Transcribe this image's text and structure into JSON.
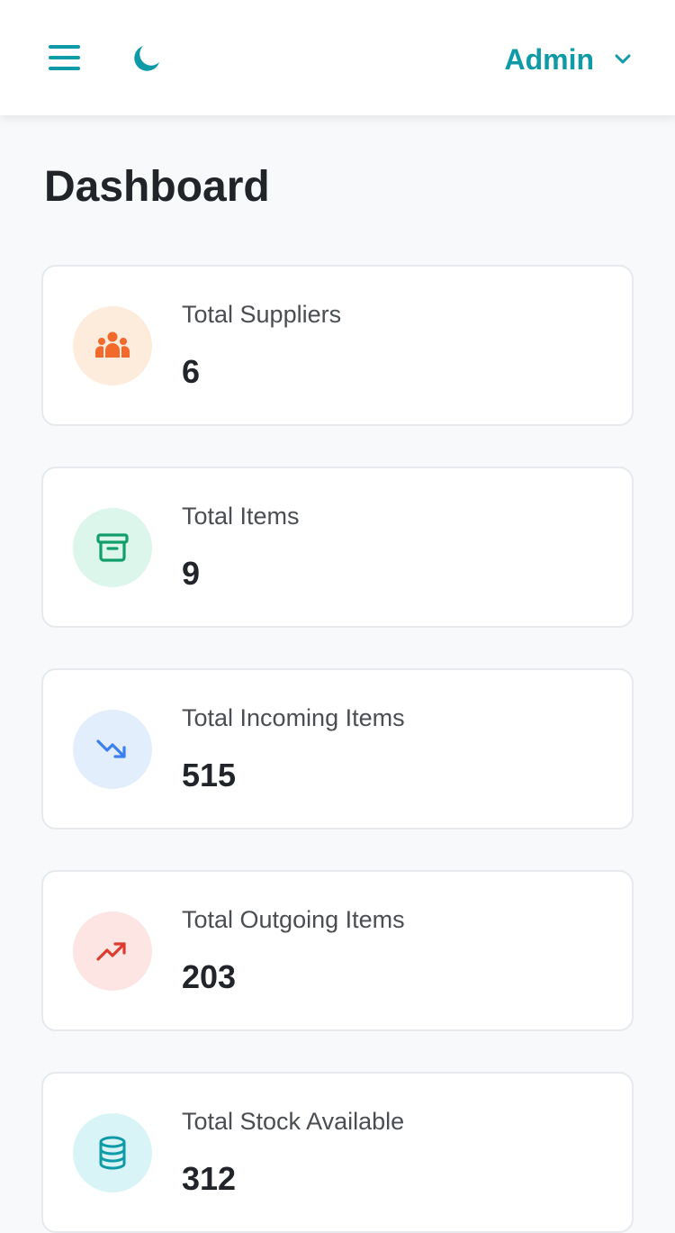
{
  "header": {
    "user_name": "Admin",
    "menu_icon": "hamburger-menu-icon",
    "theme_icon": "moon-icon",
    "dropdown_icon": "chevron-down-icon",
    "accent_color": "#0e9aa7"
  },
  "page": {
    "title": "Dashboard"
  },
  "stats": [
    {
      "label": "Total Suppliers",
      "value": "6",
      "icon": "users-icon",
      "icon_color": "#f26a2b",
      "icon_bg": "#fdebdc"
    },
    {
      "label": "Total Items",
      "value": "9",
      "icon": "archive-box-icon",
      "icon_color": "#129e6b",
      "icon_bg": "#ddf6ec"
    },
    {
      "label": "Total Incoming Items",
      "value": "515",
      "icon": "trending-down-icon",
      "icon_color": "#3b7ff0",
      "icon_bg": "#e2eefc"
    },
    {
      "label": "Total Outgoing Items",
      "value": "203",
      "icon": "trending-up-icon",
      "icon_color": "#dc3b2e",
      "icon_bg": "#fce5e3"
    },
    {
      "label": "Total Stock Available",
      "value": "312",
      "icon": "database-icon",
      "icon_color": "#0e9aa7",
      "icon_bg": "#d9f4f6"
    }
  ]
}
